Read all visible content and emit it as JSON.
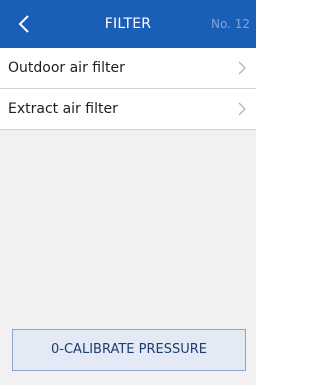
{
  "header": {
    "title": "FILTER",
    "screen_number": "No. 12",
    "back_icon": "chevron-left-icon",
    "background_color": "#1a5fb7"
  },
  "menu": {
    "items": [
      {
        "label": "Outdoor air filter",
        "icon": "chevron-right-icon"
      },
      {
        "label": "Extract air filter",
        "icon": "chevron-right-icon"
      }
    ]
  },
  "footer": {
    "calibrate_label": "0-CALIBRATE PRESSURE"
  }
}
